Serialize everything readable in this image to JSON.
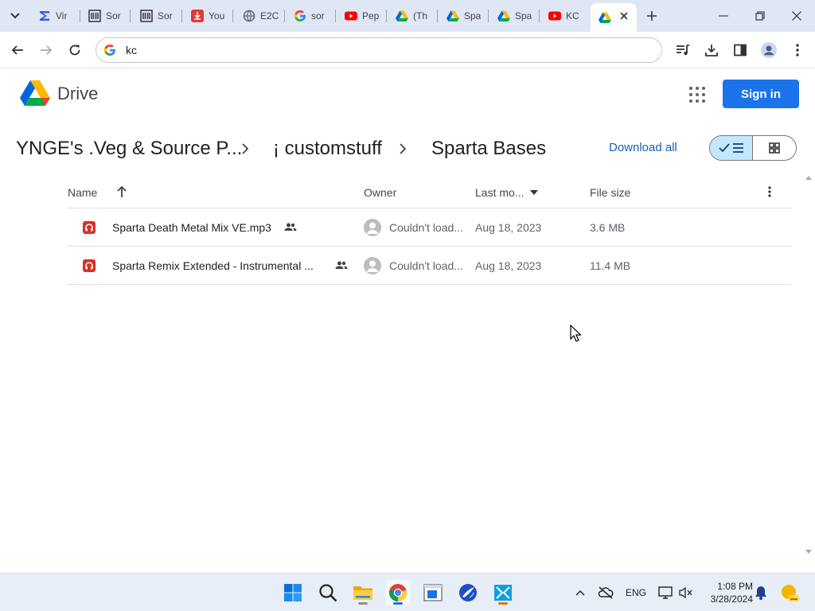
{
  "browser": {
    "tabs": [
      {
        "title": "Vir",
        "icon": "vimeo-like-icon",
        "color": "#3b5bdb"
      },
      {
        "title": "Sor",
        "icon": "library-icon",
        "color": "#333333"
      },
      {
        "title": "Sor",
        "icon": "library-icon",
        "color": "#333333"
      },
      {
        "title": "You",
        "icon": "youtube-download-icon",
        "color": "#e53935"
      },
      {
        "title": "E2C",
        "icon": "globe-icon",
        "color": "#5f6368"
      },
      {
        "title": "sor",
        "icon": "google-icon",
        "color": "#4285f4"
      },
      {
        "title": "Pep",
        "icon": "youtube-icon",
        "color": "#ff0000"
      },
      {
        "title": "(Th",
        "icon": "google-drive-icon",
        "color": "#1a73e8"
      },
      {
        "title": "Spa",
        "icon": "google-drive-icon",
        "color": "#1a73e8"
      },
      {
        "title": "Spa",
        "icon": "google-drive-icon",
        "color": "#1a73e8"
      },
      {
        "title": "KC",
        "icon": "youtube-icon",
        "color": "#ff0000"
      },
      {
        "title": "",
        "icon": "google-drive-icon",
        "color": "#1a73e8",
        "active": true
      }
    ],
    "address": "kc"
  },
  "drive": {
    "name": "Drive",
    "sign_in": "Sign in",
    "breadcrumb": [
      "YNGE's .Veg & Source P...",
      "¡ customstuff",
      "Sparta Bases"
    ],
    "download_all": "Download all",
    "view_mode": "list"
  },
  "table": {
    "headers": {
      "name": "Name",
      "owner": "Owner",
      "modified": "Last mo...",
      "size": "File size"
    },
    "sort": {
      "column": "Name",
      "direction": "ascending"
    },
    "rows": [
      {
        "name": "Sparta Death Metal Mix VE.mp3",
        "owner": "Couldn't load...",
        "modified": "Aug 18, 2023",
        "size": "3.6 MB",
        "shared": true
      },
      {
        "name": "Sparta Remix Extended - Instrumental ...",
        "owner": "Couldn't load...",
        "modified": "Aug 18, 2023",
        "size": "11.4 MB",
        "shared": true
      }
    ]
  },
  "taskbar": {
    "apps": [
      "windows-start-icon",
      "search-icon",
      "file-explorer-icon",
      "chrome-icon",
      "app-window-icon",
      "media-player-icon",
      "video-editor-icon"
    ],
    "language": "ENG",
    "time": "1:08 PM",
    "date": "3/28/2024"
  },
  "colors": {
    "accent": "#1a73e8",
    "toggle_active": "#c2e7ff",
    "audio_file": "#d93025"
  }
}
